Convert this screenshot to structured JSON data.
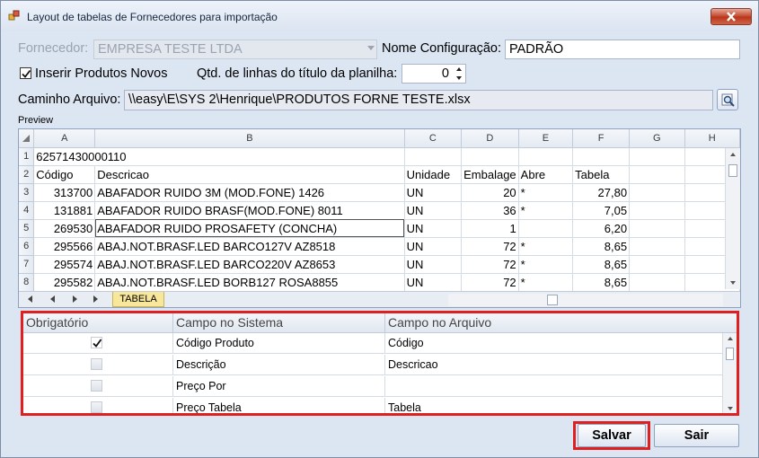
{
  "window": {
    "title": "Layout de tabelas de Fornecedores para importação"
  },
  "form": {
    "fornecedor_label": "Fornecedor:",
    "fornecedor_value": "EMPRESA TESTE LTDA",
    "nome_config_label": "Nome Configuração:",
    "nome_config_value": "PADRÃO",
    "inserir_label": "Inserir Produtos Novos",
    "inserir_checked": true,
    "qtd_label": "Qtd. de linhas do título da planilha:",
    "qtd_value": "0",
    "caminho_label": "Caminho Arquivo:",
    "caminho_value": "\\\\easy\\E\\SYS 2\\Henrique\\PRODUTOS FORNE TESTE.xlsx"
  },
  "preview": {
    "label": "Preview",
    "columns": [
      "A",
      "B",
      "C",
      "D",
      "E",
      "F",
      "G",
      "H"
    ],
    "rows": [
      {
        "n": "1",
        "cells": [
          "62571430000110",
          "",
          "",
          "",
          "",
          "",
          "",
          ""
        ]
      },
      {
        "n": "2",
        "cells": [
          "Código",
          "Descricao",
          "Unidade",
          "Embalage",
          "Abre",
          "Tabela",
          "",
          ""
        ]
      },
      {
        "n": "3",
        "cells": [
          "313700",
          "ABAFADOR RUIDO 3M (MOD.FONE)   1426",
          "UN",
          "20",
          "*",
          "27,80",
          "",
          ""
        ]
      },
      {
        "n": "4",
        "cells": [
          "131881",
          "ABAFADOR RUIDO BRASF(MOD.FONE) 8011",
          "UN",
          "36",
          "*",
          "7,05",
          "",
          ""
        ]
      },
      {
        "n": "5",
        "cells": [
          "269530",
          "ABAFADOR RUIDO PROSAFETY (CONCHA)",
          "UN",
          "1",
          "",
          "6,20",
          "",
          ""
        ]
      },
      {
        "n": "6",
        "cells": [
          "295566",
          "ABAJ.NOT.BRASF.LED BARCO127V AZ8518",
          "UN",
          "72",
          "*",
          "8,65",
          "",
          ""
        ]
      },
      {
        "n": "7",
        "cells": [
          "295574",
          "ABAJ.NOT.BRASF.LED BARCO220V AZ8653",
          "UN",
          "72",
          "*",
          "8,65",
          "",
          ""
        ]
      },
      {
        "n": "8",
        "cells": [
          "295582",
          "ABAJ.NOT.BRASF.LED BORB127 ROSA8855",
          "UN",
          "72",
          "*",
          "8,65",
          "",
          ""
        ]
      }
    ],
    "sheet_tab": "TABELA"
  },
  "mapping": {
    "headers": [
      "Obrigatório",
      "Campo no Sistema",
      "Campo no Arquivo"
    ],
    "rows": [
      {
        "obrigatorio": true,
        "sistema": "Código Produto",
        "arquivo": "Código"
      },
      {
        "obrigatorio": false,
        "sistema": "Descrição",
        "arquivo": "Descricao"
      },
      {
        "obrigatorio": false,
        "sistema": "Preço Por",
        "arquivo": ""
      },
      {
        "obrigatorio": false,
        "sistema": "Preço Tabela",
        "arquivo": "Tabela"
      }
    ]
  },
  "buttons": {
    "salvar": "Salvar",
    "sair": "Sair"
  },
  "colors": {
    "highlight": "#e02020",
    "sheet_tab": "#f8e79a"
  }
}
